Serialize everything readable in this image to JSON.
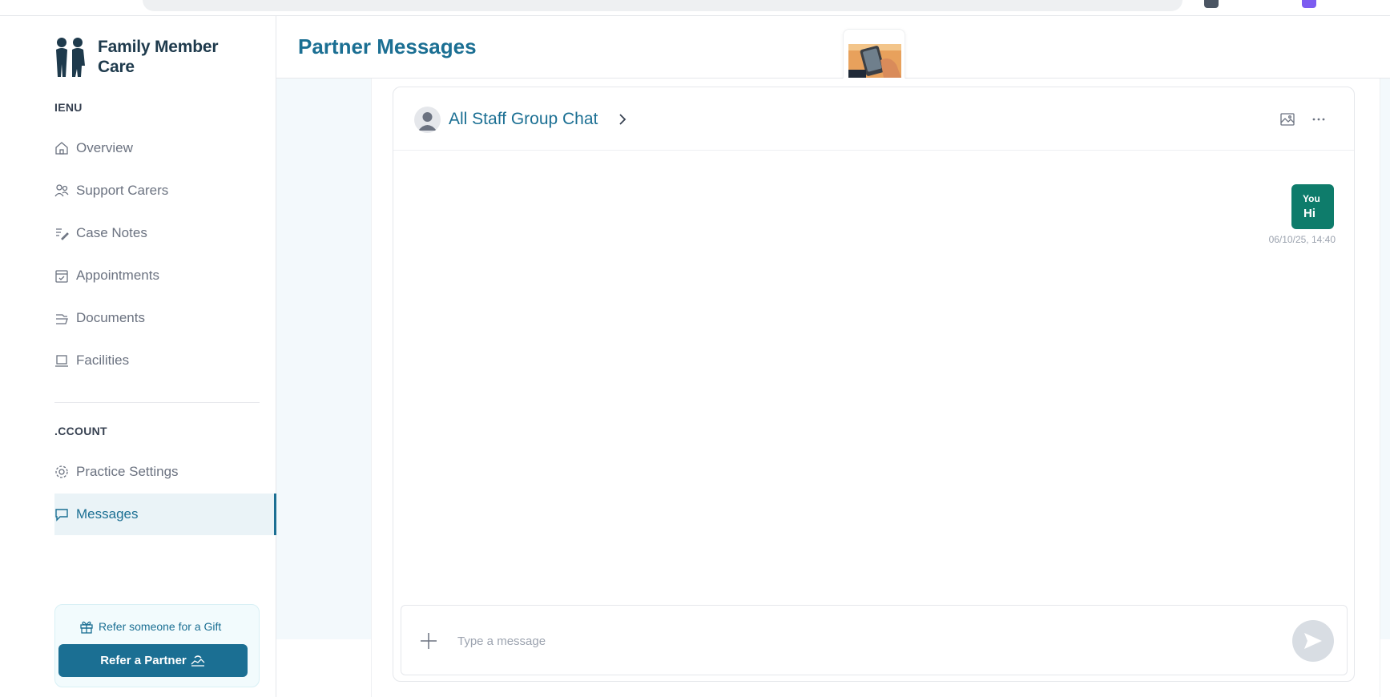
{
  "app": {
    "brand_name_line1": "Family Member",
    "brand_name_line2": "Care"
  },
  "sidebar": {
    "menu_label": "IENU",
    "account_label": ".CCOUNT",
    "menu_items": [
      {
        "label": "Overview",
        "icon": "home-icon"
      },
      {
        "label": "Support Carers",
        "icon": "users-icon"
      },
      {
        "label": "Case Notes",
        "icon": "notes-icon"
      },
      {
        "label": "Appointments",
        "icon": "calendar-icon"
      },
      {
        "label": "Documents",
        "icon": "folder-icon"
      },
      {
        "label": "Facilities",
        "icon": "laptop-icon"
      }
    ],
    "account_items": [
      {
        "label": "Practice Settings",
        "icon": "gear-icon"
      },
      {
        "label": "Messages",
        "icon": "chat-icon",
        "active": true
      }
    ],
    "refer": {
      "text": "Refer someone for a Gift",
      "button": "Refer a Partner"
    }
  },
  "header": {
    "title": "Partner Messages"
  },
  "chat": {
    "name": "All Staff Group Chat",
    "messages": [
      {
        "sender": "You",
        "text": "Hi",
        "time": "06/10/25, 14:40"
      }
    ],
    "composer_placeholder": "Type a message"
  },
  "colors": {
    "accent": "#1b6f93",
    "bubble": "#0e7c6b",
    "content_bg": "#f3f9fc"
  }
}
